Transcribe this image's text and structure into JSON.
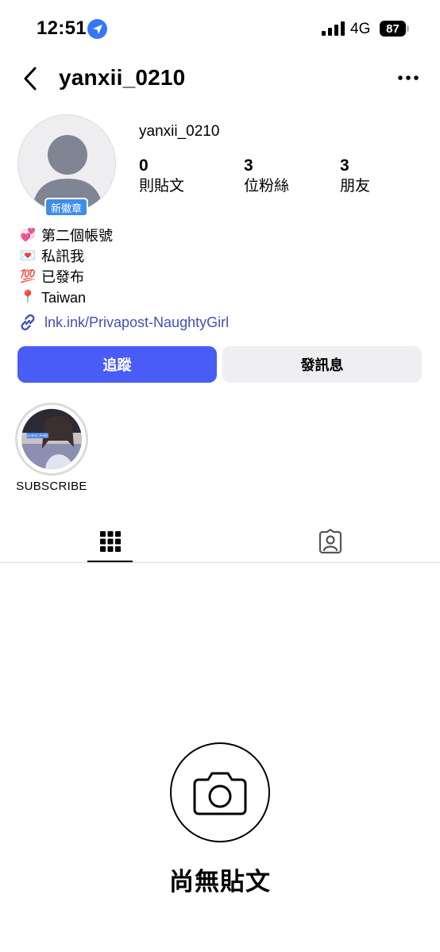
{
  "status_bar": {
    "time": "12:51",
    "network": "4G",
    "battery": "87",
    "icons": [
      "location-arrow-icon",
      "signal-icon",
      "battery-icon"
    ]
  },
  "header": {
    "title": "yanxii_0210",
    "icons": [
      "back-chevron-icon",
      "more-options-icon"
    ]
  },
  "profile": {
    "username": "yanxii_0210",
    "badge": "新徽章",
    "stats": [
      {
        "value": "0",
        "label": "則貼文"
      },
      {
        "value": "3",
        "label": "位粉絲"
      },
      {
        "value": "3",
        "label": "朋友"
      }
    ],
    "bio": [
      {
        "emoji": "💞",
        "text": "第二個帳號"
      },
      {
        "emoji": "💌",
        "text": "私訊我"
      },
      {
        "emoji": "💯",
        "text": "已發布"
      },
      {
        "emoji": "📍",
        "text": "Taiwan"
      }
    ],
    "link": "lnk.ink/Privapost-NaughtyGirl"
  },
  "actions": {
    "follow": "追蹤",
    "message": "發訊息"
  },
  "highlights": [
    {
      "label": "SUBSCRIBE",
      "thumb_text": "SUBSCRIBE"
    }
  ],
  "tabs": [
    {
      "icon": "grid-icon",
      "active": true
    },
    {
      "icon": "tagged-user-icon",
      "active": false
    }
  ],
  "empty_state": {
    "title": "尚無貼文",
    "icon": "camera-icon"
  },
  "colors": {
    "accent": "#4a5cf6",
    "link": "#3f51b5",
    "badge": "#3d8ee8",
    "location": "#3478f6",
    "secondary_button": "#efeff2"
  }
}
